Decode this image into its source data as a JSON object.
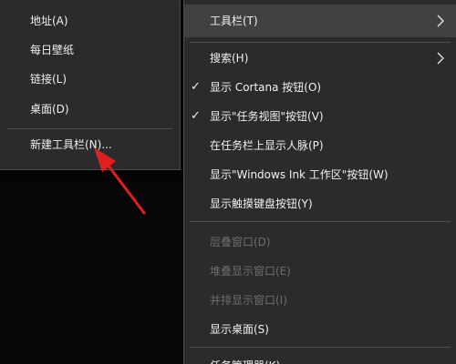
{
  "submenu": {
    "items": [
      {
        "label": "地址(A)"
      },
      {
        "label": "每日壁纸"
      },
      {
        "label": "链接(L)"
      },
      {
        "label": "桌面(D)"
      }
    ],
    "new_toolbar_label": "新建工具栏(N)..."
  },
  "main_menu": {
    "toolbars_label": "工具栏(T)",
    "search_label": "搜索(H)",
    "show_cortana_label": "显示 Cortana 按钮(O)",
    "show_task_view_label": "显示\"任务视图\"按钮(V)",
    "show_people_label": "在任务栏上显示人脉(P)",
    "show_ink_label": "显示\"Windows Ink 工作区\"按钮(W)",
    "show_touch_keyboard_label": "显示触摸键盘按钮(Y)",
    "cascade_label": "层叠窗口(D)",
    "stacked_label": "堆叠显示窗口(E)",
    "side_by_side_label": "并排显示窗口(I)",
    "show_desktop_label": "显示桌面(S)",
    "task_manager_label": "任务管理器(K)"
  },
  "colors": {
    "menu_bg": "#2b2b2b",
    "highlight_bg": "#414141",
    "text": "#f0f0f0",
    "disabled_text": "#6c6c6c",
    "annotation_arrow": "#e02020"
  },
  "icons": {
    "check": "checkmark-icon",
    "submenu": "chevron-right-icon",
    "annotation": "red-arrow-icon"
  }
}
